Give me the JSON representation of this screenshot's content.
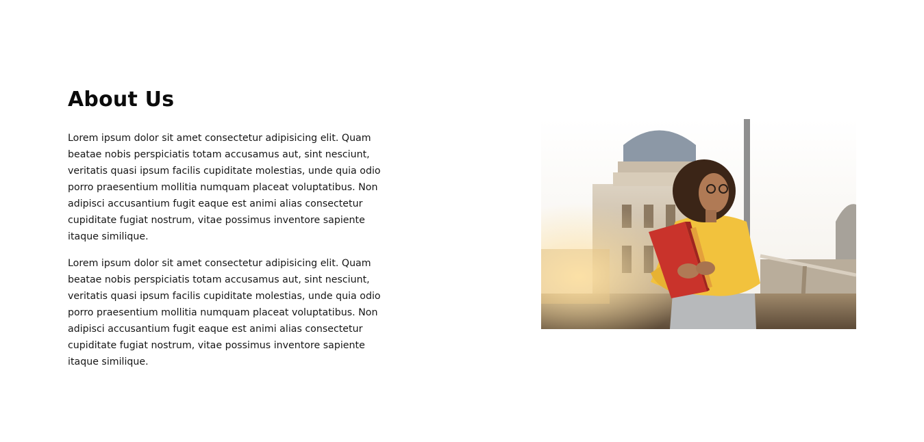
{
  "about": {
    "heading": "About Us",
    "paragraphs": [
      "Lorem ipsum dolor sit amet consectetur adipisicing elit. Quam beatae nobis perspiciatis totam accusamus aut, sint nesciunt, veritatis quasi ipsum facilis cupiditate molestias, unde quia odio porro praesentium mollitia numquam placeat voluptatibus. Non adipisci accusantium fugit eaque est animi alias consectetur cupiditate fugiat nostrum, vitae possimus inventore sapiente itaque similique.",
      "Lorem ipsum dolor sit amet consectetur adipisicing elit. Quam beatae nobis perspiciatis totam accusamus aut, sint nesciunt, veritatis quasi ipsum facilis cupiditate molestias, unde quia odio porro praesentium mollitia numquam placeat voluptatibus. Non adipisci accusantium fugit eaque est animi alias consectetur cupiditate fugiat nostrum, vitae possimus inventore sapiente itaque similique."
    ]
  },
  "colors": {
    "background": "#ffffff",
    "text": "#111111",
    "jacket": "#f2c23d",
    "book": "#c9332b"
  }
}
